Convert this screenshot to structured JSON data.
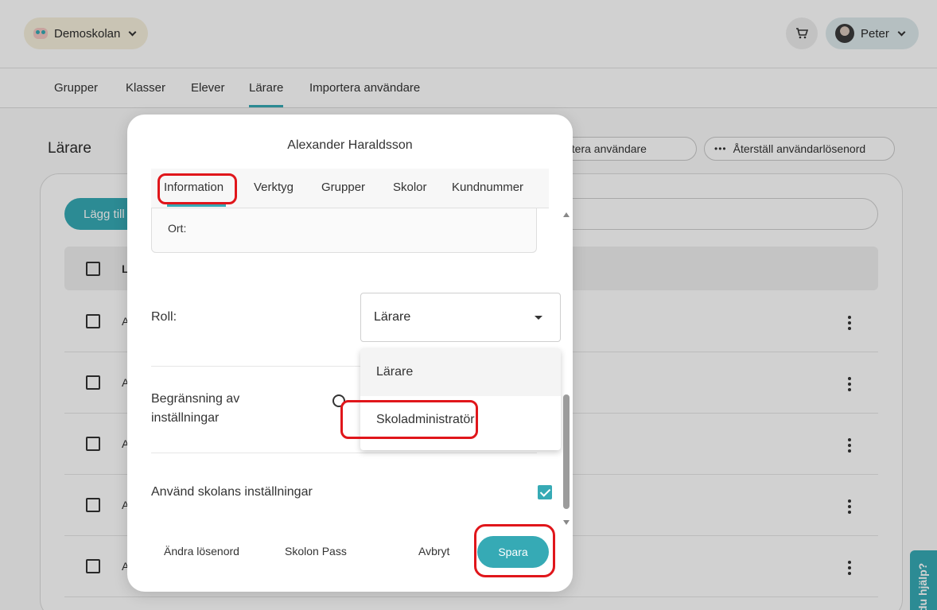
{
  "header": {
    "school_name": "Demoskolan",
    "user_name": "Peter"
  },
  "nav": {
    "tabs": [
      "Grupper",
      "Klasser",
      "Elever",
      "Lärare",
      "Importera användare"
    ],
    "active": "Lärare"
  },
  "page": {
    "title": "Lärare",
    "import_button": "Importera användare",
    "reset_password_button": "Återställ användarlösenord",
    "add_button": "Lägg till",
    "table_header_letter": "L",
    "row_letters": [
      "A",
      "A",
      "A",
      "A",
      "A"
    ]
  },
  "help": {
    "label": "du hjälp?"
  },
  "modal": {
    "title": "Alexander Haraldsson",
    "tabs": [
      "Information",
      "Verktyg",
      "Grupper",
      "Skolor",
      "Kundnummer"
    ],
    "active_tab": "Information",
    "ort_label": "Ort:",
    "role_label": "Roll:",
    "role_value": "Lärare",
    "role_options": [
      "Lärare",
      "Skoladministratör"
    ],
    "limit_label_line1": "Begränsning av",
    "limit_label_line2": "inställningar",
    "use_school_settings_label": "Använd skolans inställningar",
    "use_school_settings_checked": true,
    "footer": {
      "change_password": "Ändra lösenord",
      "skolon_pass": "Skolon Pass",
      "cancel": "Avbryt",
      "save": "Spara"
    }
  },
  "colors": {
    "accent": "#36aab5",
    "annotation": "#e0161b"
  }
}
